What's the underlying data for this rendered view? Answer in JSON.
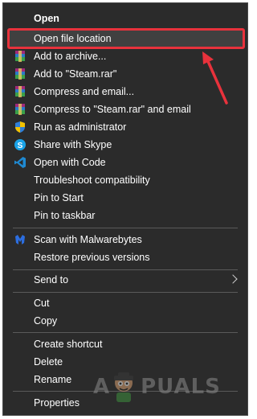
{
  "menu": {
    "items": [
      {
        "label": "Open",
        "bold": true
      },
      {
        "label": "Open file location"
      },
      {
        "label": "Add to archive...",
        "icon": "winrar-icon"
      },
      {
        "label": "Add to \"Steam.rar\"",
        "icon": "winrar-icon"
      },
      {
        "label": "Compress and email...",
        "icon": "winrar-icon"
      },
      {
        "label": "Compress to \"Steam.rar\" and email",
        "icon": "winrar-icon"
      },
      {
        "label": "Run as administrator",
        "icon": "uac-shield-icon"
      },
      {
        "label": "Share with Skype",
        "icon": "skype-icon"
      },
      {
        "label": "Open with Code",
        "icon": "vscode-icon"
      },
      {
        "label": "Troubleshoot compatibility"
      },
      {
        "label": "Pin to Start"
      },
      {
        "label": "Pin to taskbar"
      },
      {
        "label": "Scan with Malwarebytes",
        "icon": "malwarebytes-icon"
      },
      {
        "label": "Restore previous versions"
      },
      {
        "label": "Send to",
        "submenu": true
      },
      {
        "label": "Cut"
      },
      {
        "label": "Copy"
      },
      {
        "label": "Create shortcut"
      },
      {
        "label": "Delete"
      },
      {
        "label": "Rename"
      },
      {
        "label": "Properties"
      }
    ]
  },
  "highlight": {
    "target": "Open file location",
    "color": "#e8323c"
  },
  "watermark": {
    "left": "A",
    "right": "PUALS"
  }
}
